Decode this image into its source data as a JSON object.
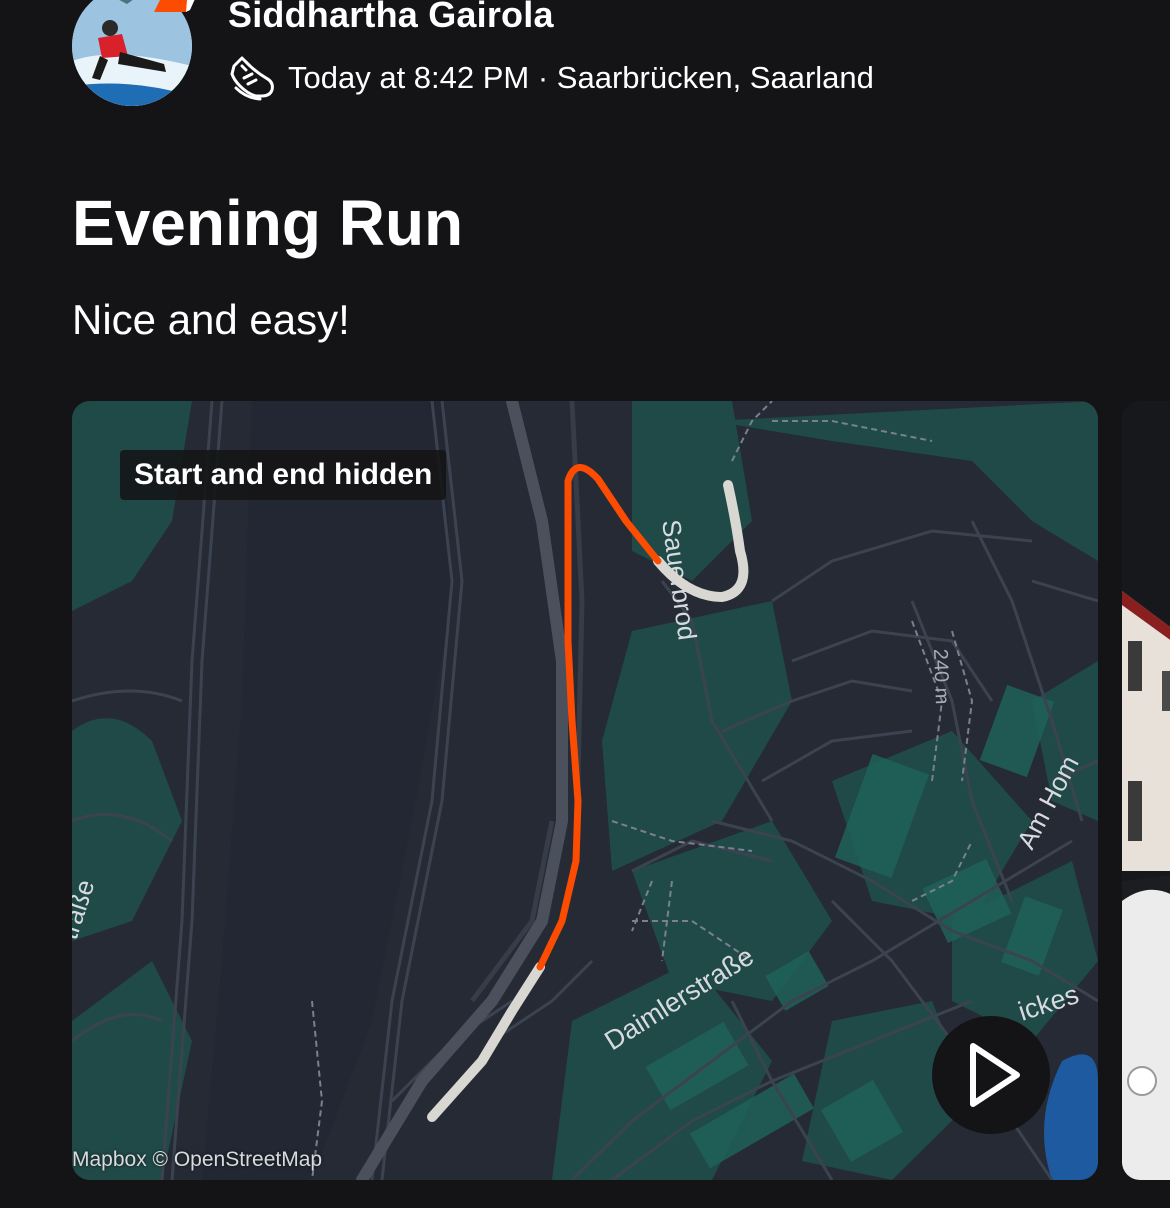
{
  "athlete": {
    "name": "Siddhartha Gairola",
    "avatar_icon": "athlete-avatar",
    "badge_color": "#fc4c02"
  },
  "activity": {
    "type_icon": "running-shoe-icon",
    "meta": "Today at 8:42 PM · Saarbrücken, Saarland",
    "title": "Evening Run",
    "description": "Nice and easy!"
  },
  "map": {
    "privacy_label": "Start and end hidden",
    "attribution": "Mapbox © OpenStreetMap",
    "route_color": "#fc4c02",
    "hidden_route_color": "#d9d7d2",
    "street_labels": [
      "Daimlerstraße",
      "Am Hom",
      "Sauerbrod",
      "traße",
      "ickes"
    ],
    "elevation_label": "240 m",
    "play_icon": "play-icon"
  }
}
